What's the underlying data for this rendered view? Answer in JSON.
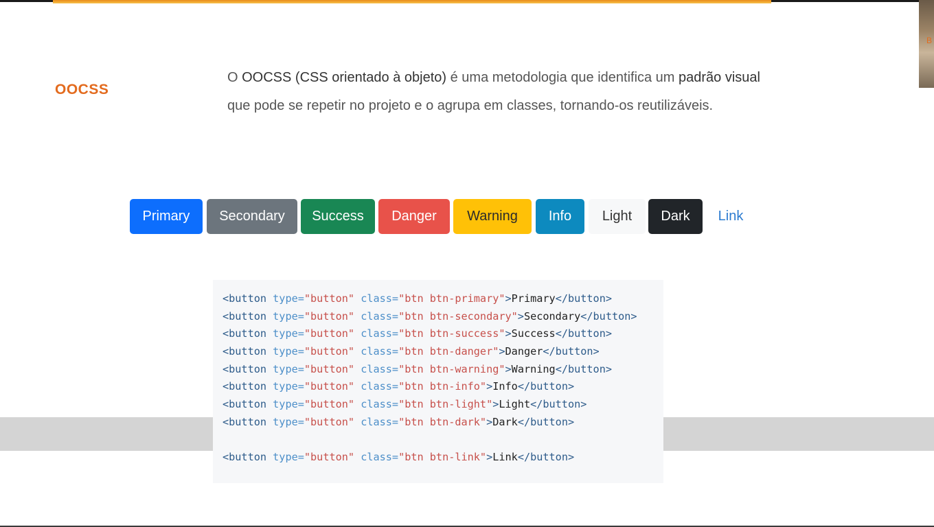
{
  "section_title": "OOCSS",
  "description": {
    "part1": "O ",
    "strong1": "OOCSS (CSS orientado à objeto)",
    "part2": " é uma metodologia que identifica um ",
    "strong2": "padrão visual",
    "part3": " que pode se repetir no projeto e o agrupa em classes, tornando-os reutilizáveis."
  },
  "webcam_letter": "B",
  "buttons": {
    "primary": "Primary",
    "secondary": "Secondary",
    "success": "Success",
    "danger": "Danger",
    "warning": "Warning",
    "info": "Info",
    "light": "Light",
    "dark": "Dark",
    "link": "Link"
  },
  "code": {
    "open_tag": "<button",
    "type_attr": " type=",
    "type_val": "\"button\"",
    "class_attr": " class=",
    "close_bracket": ">",
    "end_tag": "</button>",
    "lines": [
      {
        "cls": "\"btn btn-primary\"",
        "text": "Primary"
      },
      {
        "cls": "\"btn btn-secondary\"",
        "text": "Secondary"
      },
      {
        "cls": "\"btn btn-success\"",
        "text": "Success"
      },
      {
        "cls": "\"btn btn-danger\"",
        "text": "Danger"
      },
      {
        "cls": "\"btn btn-warning\"",
        "text": "Warning"
      },
      {
        "cls": "\"btn btn-info\"",
        "text": "Info"
      },
      {
        "cls": "\"btn btn-light\"",
        "text": "Light"
      },
      {
        "cls": "\"btn btn-dark\"",
        "text": "Dark"
      },
      {
        "cls": "",
        "text": ""
      },
      {
        "cls": "\"btn btn-link\"",
        "text": "Link"
      }
    ]
  },
  "colors": {
    "accent": "#e36b1e",
    "primary": "#0d6efd",
    "secondary": "#6c757d",
    "success": "#198754",
    "danger": "#e8524a",
    "warning": "#ffc107",
    "info": "#0d8abf",
    "light": "#f7f8f9",
    "dark": "#212529",
    "link": "#2b7bd0"
  }
}
